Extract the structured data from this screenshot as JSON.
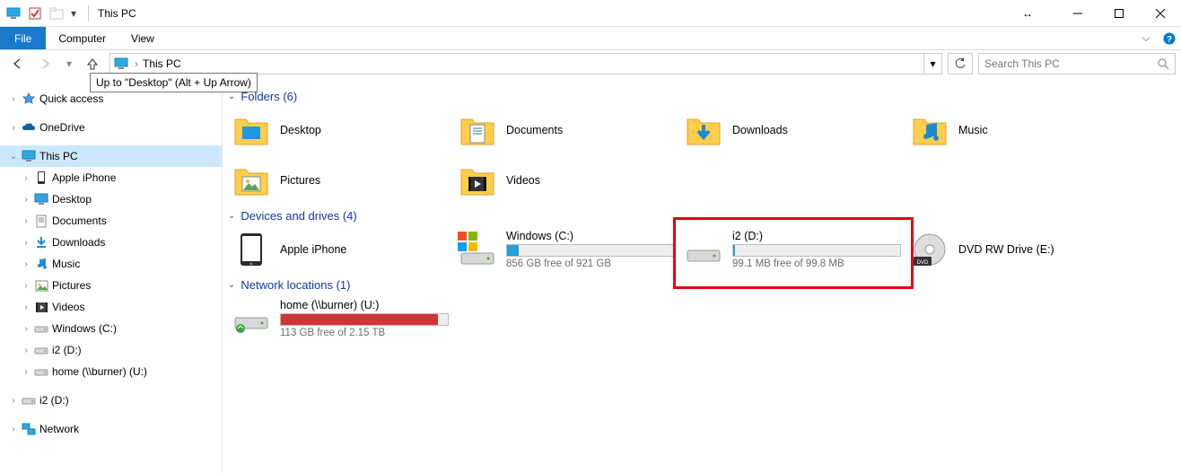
{
  "window": {
    "title": "This PC"
  },
  "menubar": {
    "file": "File",
    "tabs": [
      "Computer",
      "View"
    ]
  },
  "nav": {
    "breadcrumb_root": "This PC",
    "tooltip": "Up to \"Desktop\" (Alt + Up Arrow)",
    "search_placeholder": "Search This PC"
  },
  "sidebar": {
    "quick_access": "Quick access",
    "onedrive": "OneDrive",
    "this_pc": "This PC",
    "children": [
      "Apple iPhone",
      "Desktop",
      "Documents",
      "Downloads",
      "Music",
      "Pictures",
      "Videos",
      "Windows (C:)",
      "i2 (D:)",
      "home (\\\\burner) (U:)"
    ],
    "i2_again": "i2 (D:)",
    "network": "Network"
  },
  "groups": {
    "folders": {
      "title": "Folders (6)",
      "items": [
        "Desktop",
        "Documents",
        "Downloads",
        "Music",
        "Pictures",
        "Videos"
      ]
    },
    "drives": {
      "title": "Devices and drives (4)",
      "items": [
        {
          "name": "Apple iPhone"
        },
        {
          "name": "Windows (C:)",
          "sub": "856 GB free of 921 GB",
          "fill": 7
        },
        {
          "name": "i2 (D:)",
          "sub": "99.1 MB free of 99.8 MB",
          "fill": 1,
          "highlight": true
        },
        {
          "name": "DVD RW Drive (E:)"
        }
      ]
    },
    "netloc": {
      "title": "Network locations (1)",
      "items": [
        {
          "name": "home (\\\\burner) (U:)",
          "sub": "113 GB free of 2.15 TB",
          "fill": 94,
          "red": true
        }
      ]
    }
  }
}
